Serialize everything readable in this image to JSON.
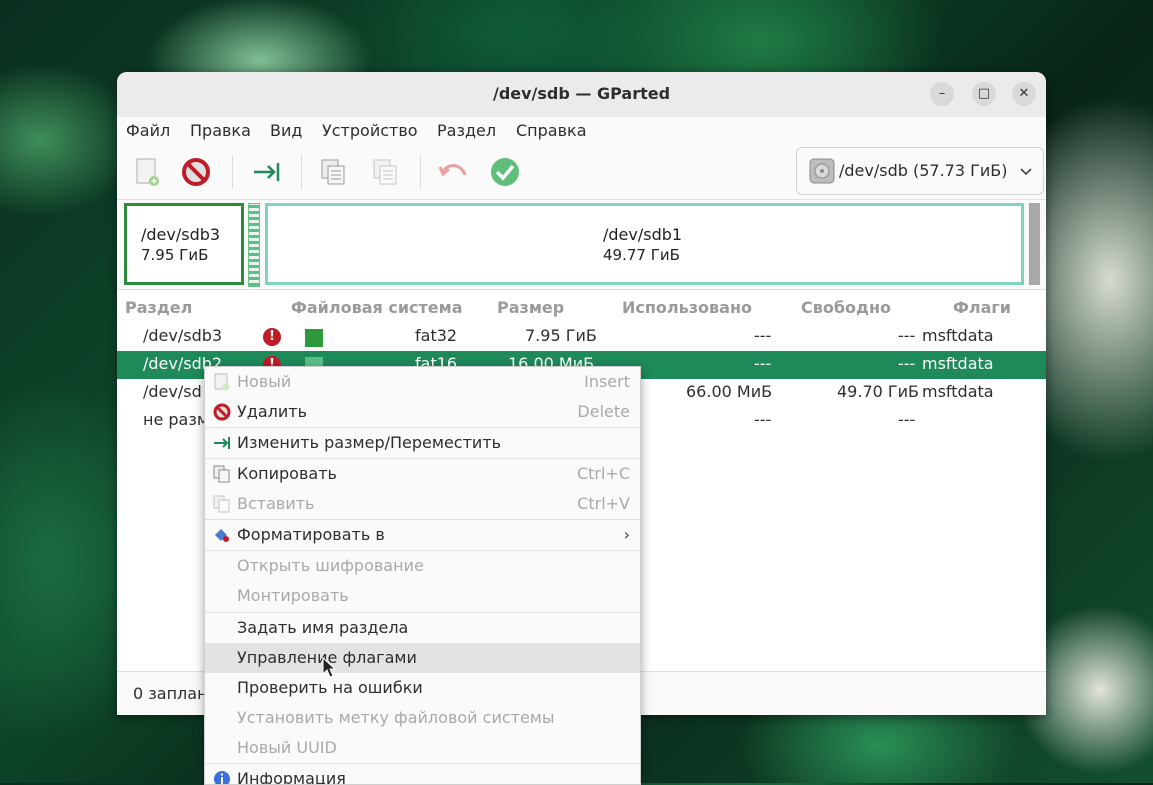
{
  "window": {
    "title": "/dev/sdb — GParted",
    "controls": {
      "minimize": "–",
      "maximize": "□",
      "close": "✕"
    }
  },
  "menubar": [
    "Файл",
    "Правка",
    "Вид",
    "Устройство",
    "Раздел",
    "Справка"
  ],
  "toolbar": {
    "buttons": [
      "new-icon",
      "delete-icon",
      "resize-icon",
      "copy-icon",
      "paste-icon",
      "undo-icon",
      "apply-icon"
    ],
    "device": "/dev/sdb (57.73 ГиБ)"
  },
  "disk_graph": {
    "sdb3": {
      "name": "/dev/sdb3",
      "size": "7.95 ГиБ"
    },
    "sdb1": {
      "name": "/dev/sdb1",
      "size": "49.77 ГиБ"
    }
  },
  "table": {
    "headers": [
      "Раздел",
      "Файловая система",
      "Размер",
      "Использовано",
      "Свободно",
      "Флаги"
    ],
    "rows": [
      {
        "partition": "/dev/sdb3",
        "fs": "fat32",
        "size": "7.95 ГиБ",
        "used": "---",
        "free": "---",
        "flags": "msftdata",
        "fs_color": "#2e9a3e"
      },
      {
        "partition": "/dev/sdb2",
        "fs": "fat16",
        "size": "16.00 МиБ",
        "used": "---",
        "free": "---",
        "flags": "msftdata",
        "fs_color": "#58c08a"
      },
      {
        "partition": "/dev/sd",
        "used": "66.00 МиБ",
        "free": "49.70 ГиБ",
        "flags": "msftdata"
      },
      {
        "partition": "не разм",
        "used": "---",
        "free": "---"
      }
    ]
  },
  "statusbar": {
    "text": "0 заплан"
  },
  "context_menu": [
    {
      "label": "Новый",
      "accel": "Insert",
      "disabled": true
    },
    {
      "label": "Удалить",
      "accel": "Delete",
      "disabled": false
    },
    {
      "label": "Изменить размер/Переместить",
      "accel": "",
      "disabled": false
    },
    {
      "label": "Копировать",
      "accel": "Ctrl+C",
      "disabled": false
    },
    {
      "label": "Вставить",
      "accel": "Ctrl+V",
      "disabled": true
    },
    {
      "label": "Форматировать в",
      "accel": "›",
      "disabled": false
    },
    {
      "label": "Открыть шифрование",
      "accel": "",
      "disabled": true
    },
    {
      "label": "Монтировать",
      "accel": "",
      "disabled": true
    },
    {
      "label": "Задать имя раздела",
      "accel": "",
      "disabled": false
    },
    {
      "label": "Управление флагами",
      "accel": "",
      "disabled": false,
      "highlighted": true
    },
    {
      "label": "Проверить на ошибки",
      "accel": "",
      "disabled": false
    },
    {
      "label": "Установить метку файловой системы",
      "accel": "",
      "disabled": true
    },
    {
      "label": "Новый UUID",
      "accel": "",
      "disabled": true
    },
    {
      "label": "Информация",
      "accel": "",
      "disabled": false
    }
  ],
  "colors": {
    "selection": "#1e8a5a",
    "accent_green": "#2e8b3c",
    "sdb1_border": "#7fd4bf",
    "error": "#c01c28"
  }
}
